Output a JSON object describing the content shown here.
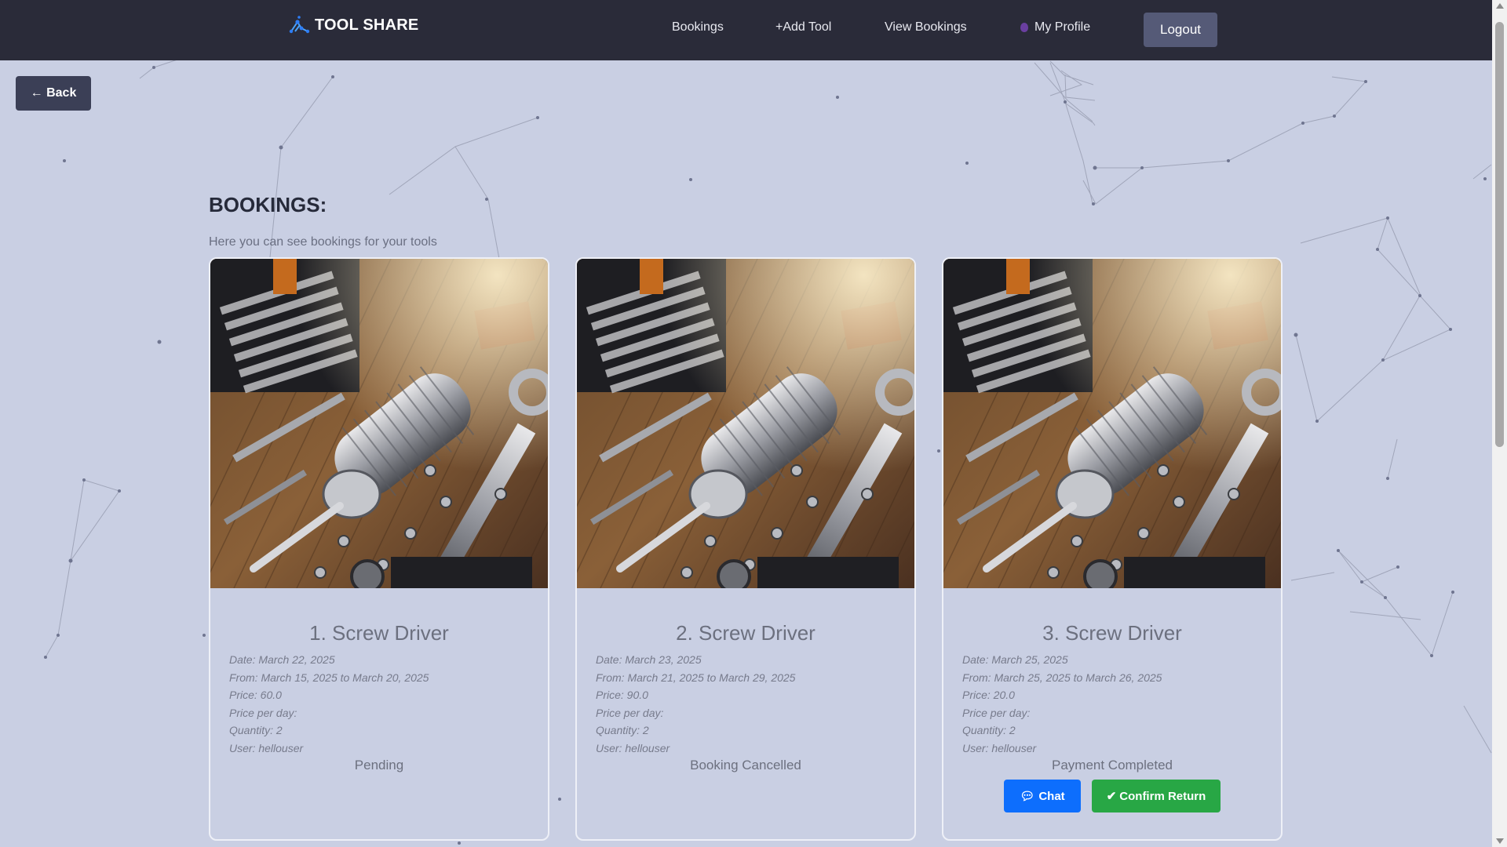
{
  "app": {
    "brand": "TOOL SHARE"
  },
  "nav": {
    "bookings": "Bookings",
    "add_tool": "+Add Tool",
    "view_bookings": "View Bookings",
    "my_profile": "My Profile",
    "logout": "Logout"
  },
  "back_label": "← Back",
  "page": {
    "title": "BOOKINGS:",
    "subtitle": "Here you can see bookings for your tools"
  },
  "bookings": [
    {
      "title": "1. Screw Driver",
      "date": "Date: March 22, 2025",
      "range": "From: March 15, 2025 to March 20, 2025",
      "price": "Price: 60.0",
      "price_per_day": "Price per day:",
      "quantity": "Quantity: 2",
      "user": "User: hellouser",
      "status": "Pending"
    },
    {
      "title": "2. Screw Driver",
      "date": "Date: March 23, 2025",
      "range": "From: March 21, 2025 to March 29, 2025",
      "price": "Price: 90.0",
      "price_per_day": "Price per day:",
      "quantity": "Quantity: 2",
      "user": "User: hellouser",
      "status": "Booking Cancelled"
    },
    {
      "title": "3. Screw Driver",
      "date": "Date: March 25, 2025",
      "range": "From: March 25, 2025 to March 26, 2025",
      "price": "Price: 20.0",
      "price_per_day": "Price per day:",
      "quantity": "Quantity: 2",
      "user": "User: hellouser",
      "status": "Payment Completed",
      "actions": {
        "chat": "Chat",
        "confirm_return": "Confirm Return"
      }
    }
  ],
  "colors": {
    "navbar": "#2a2b39",
    "background": "#c9cfe3",
    "chat_button": "#0d6efd",
    "confirm_button": "#28a745",
    "logout_button": "#555a77"
  },
  "icons": {
    "brand": "network-logo-icon",
    "profile": "profile-dot-icon",
    "chat": "speech-bubble-icon",
    "confirm": "check-icon"
  }
}
